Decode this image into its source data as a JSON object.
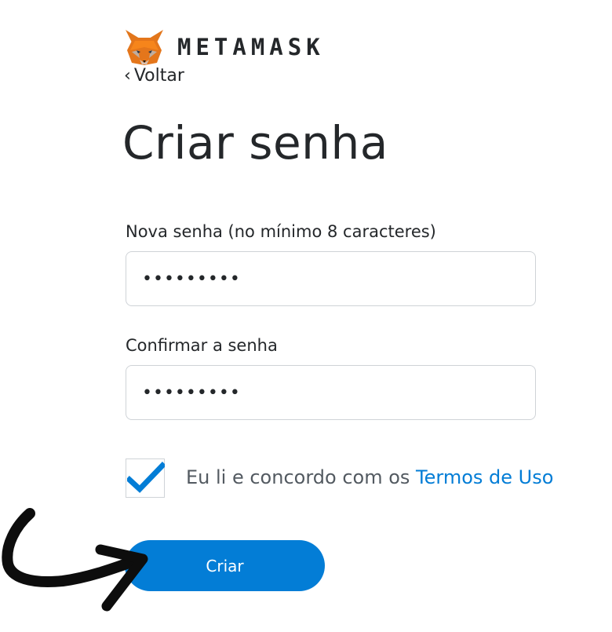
{
  "header": {
    "brand": "METAMASK",
    "back_label": "Voltar"
  },
  "page": {
    "title": "Criar senha"
  },
  "form": {
    "new_password_label": "Nova senha (no mínimo 8 caracteres)",
    "new_password_value": "•••••••••",
    "confirm_password_label": "Confirmar a senha",
    "confirm_password_value": "•••••••••",
    "terms_checked": true,
    "terms_text": "Eu li e concordo com os ",
    "terms_link": "Termos de Uso",
    "submit_label": "Criar"
  },
  "colors": {
    "accent": "#037dd6",
    "text": "#24272a",
    "muted_text": "#535a61",
    "border": "#cfd3d7"
  },
  "icons": {
    "logo": "metamask-fox-icon",
    "back": "chevron-left-icon",
    "check": "checkmark-icon",
    "annotation": "curved-arrow-icon"
  }
}
